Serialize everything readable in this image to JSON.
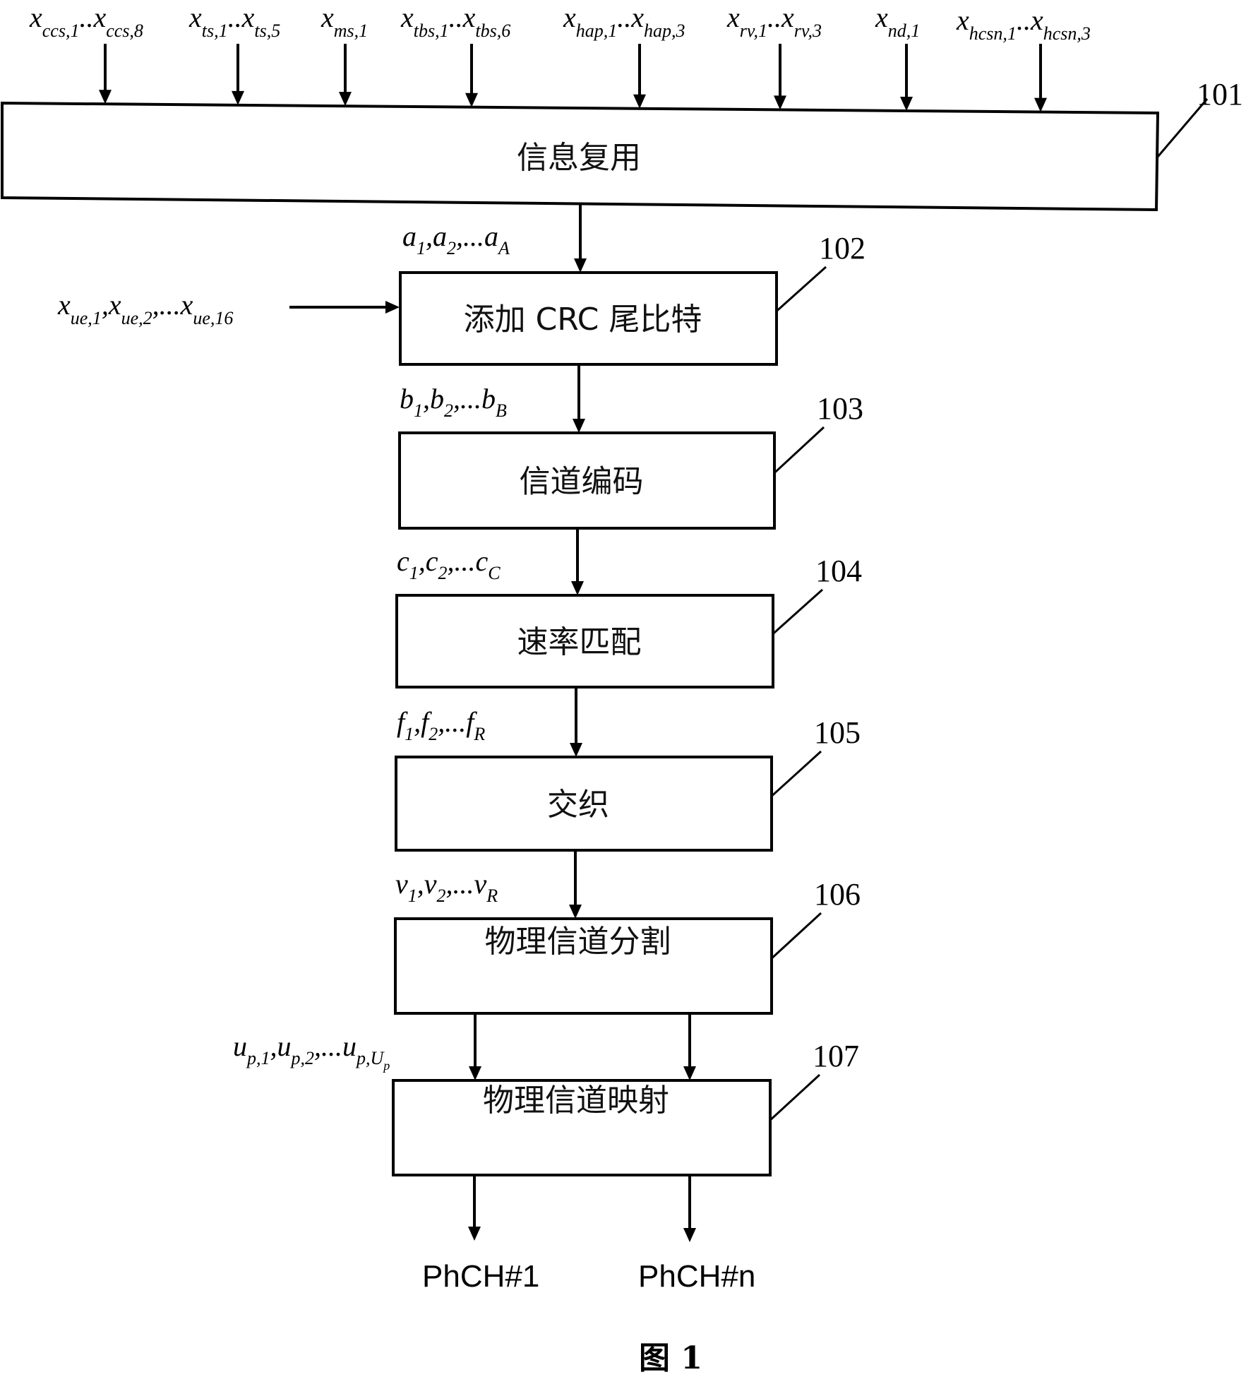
{
  "figure_label": "图 1",
  "top_inputs": [
    {
      "base": "x",
      "first_sub": "ccs,1",
      "sep": "..",
      "last_sub": "ccs,8"
    },
    {
      "base": "x",
      "first_sub": "ts,1",
      "sep": "..",
      "last_sub": "ts,5"
    },
    {
      "base": "x",
      "first_sub": "ms,1",
      "sep": "",
      "last_sub": ""
    },
    {
      "base": "x",
      "first_sub": "tbs,1",
      "sep": "..",
      "last_sub": "tbs,6"
    },
    {
      "base": "x",
      "first_sub": "hap,1",
      "sep": "..",
      "last_sub": "hap,3"
    },
    {
      "base": "x",
      "first_sub": "rv,1",
      "sep": "..",
      "last_sub": "rv,3"
    },
    {
      "base": "x",
      "first_sub": "nd,1",
      "sep": "",
      "last_sub": ""
    },
    {
      "base": "x",
      "first_sub": "hcsn,1",
      "sep": "..",
      "last_sub": "hcsn,3"
    }
  ],
  "side_input": {
    "text": "x",
    "parts": [
      {
        "base": "x",
        "sub": "ue,1"
      },
      {
        "base": "x",
        "sub": "ue,2"
      },
      {
        "base": "x",
        "sub": "ue,16"
      }
    ],
    "joiners": [
      ",",
      ",..."
    ]
  },
  "blocks": [
    {
      "id": "101",
      "label": "信息复用"
    },
    {
      "id": "102",
      "label": "添加 CRC 尾比特"
    },
    {
      "id": "103",
      "label": "信道编码"
    },
    {
      "id": "104",
      "label": "速率匹配"
    },
    {
      "id": "105",
      "label": "交织"
    },
    {
      "id": "106",
      "label": "物理信道分割"
    },
    {
      "id": "107",
      "label": "物理信道映射"
    }
  ],
  "signals": [
    {
      "between": "101-102",
      "base": "a",
      "s1": "1",
      "s2": "2",
      "sn": "A"
    },
    {
      "between": "102-103",
      "base": "b",
      "s1": "1",
      "s2": "2",
      "sn": "B"
    },
    {
      "between": "103-104",
      "base": "c",
      "s1": "1",
      "s2": "2",
      "sn": "C"
    },
    {
      "between": "104-105",
      "base": "f",
      "s1": "1",
      "s2": "2",
      "sn": "R"
    },
    {
      "between": "105-106",
      "base": "v",
      "s1": "1",
      "s2": "2",
      "sn": "R"
    },
    {
      "between": "106-107",
      "base": "u",
      "s1": "p,1",
      "s2": "p,2",
      "sn": "p,U_p"
    }
  ],
  "outputs": [
    "PhCH#1",
    "PhCH#n"
  ],
  "colors": {
    "stroke": "#000000",
    "background": "#ffffff"
  }
}
